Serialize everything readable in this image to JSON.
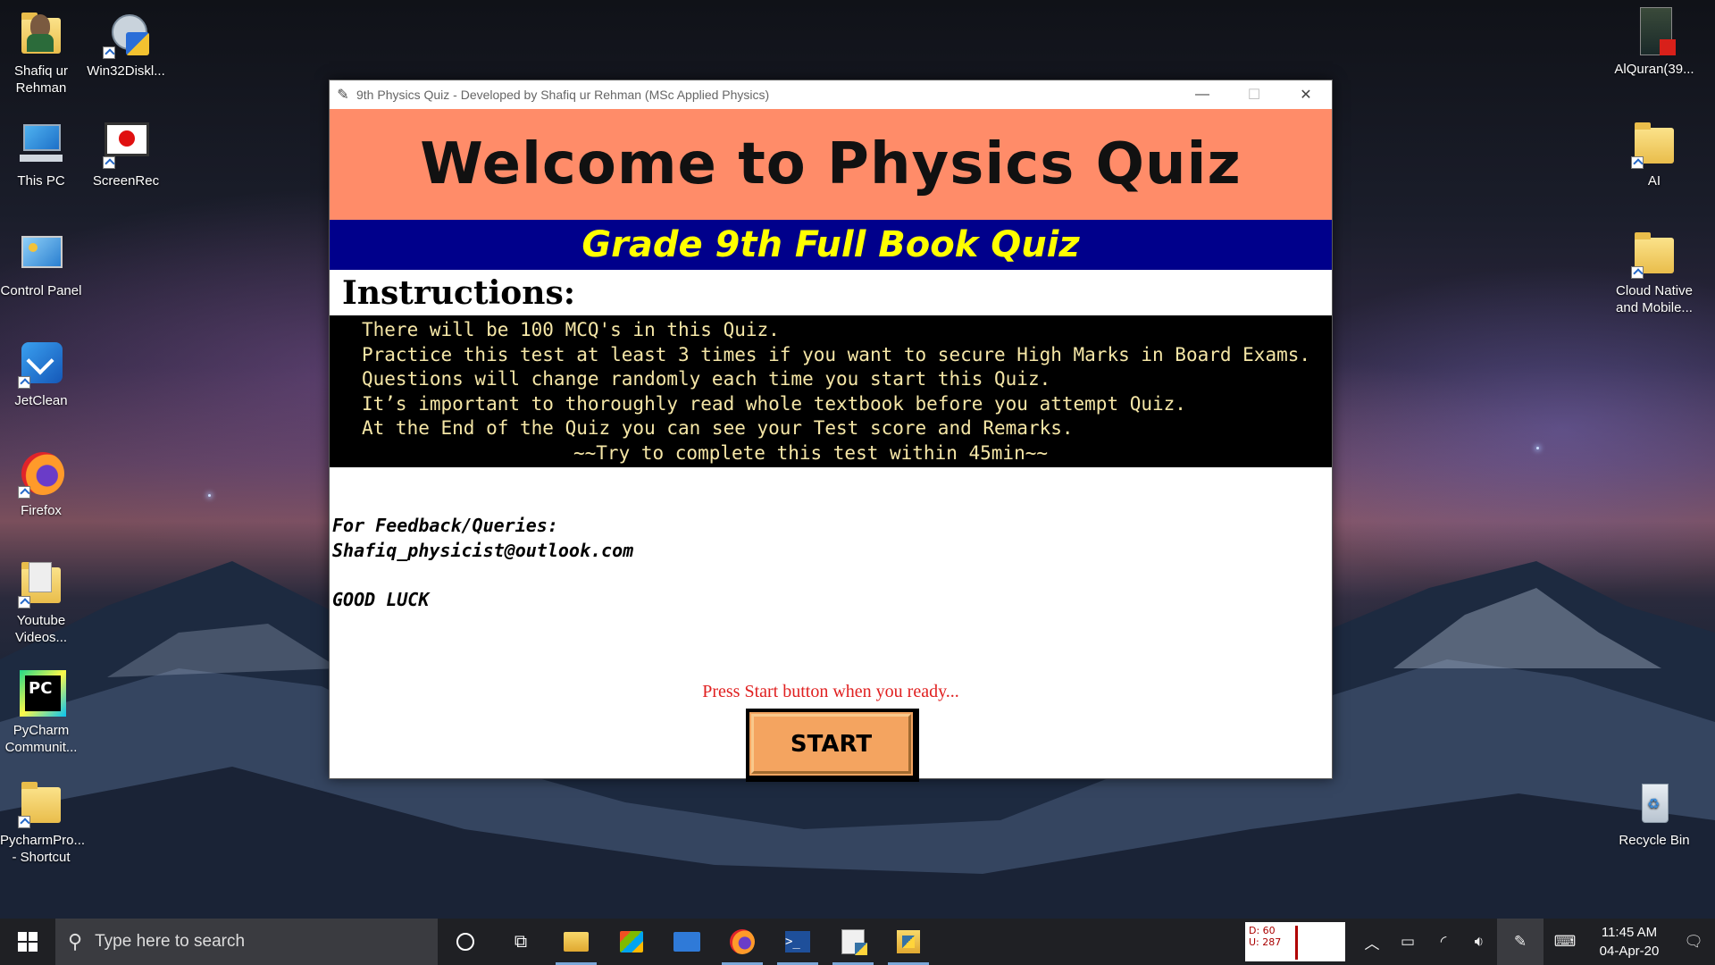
{
  "desktop": {
    "left_icons": [
      {
        "label": "Shafiq ur Rehman",
        "icon": "user-folder-icon"
      },
      {
        "label": "Win32Diskl...",
        "icon": "win32-disk-imager-icon"
      },
      {
        "label": "This PC",
        "icon": "computer-icon"
      },
      {
        "label": "ScreenRec",
        "icon": "screen-recorder-icon"
      },
      {
        "label": "Control Panel",
        "icon": "control-panel-icon"
      },
      {
        "label": "JetClean",
        "icon": "jetclean-icon"
      },
      {
        "label": "Firefox",
        "icon": "firefox-icon"
      },
      {
        "label": "Youtube Videos...",
        "icon": "folder-icon"
      },
      {
        "label": "PyCharm Communit...",
        "icon": "pycharm-icon"
      },
      {
        "label": "PycharmPro... - Shortcut",
        "icon": "folder-icon"
      }
    ],
    "right_icons": [
      {
        "label": "AlQuran(39...",
        "icon": "pdf-book-icon"
      },
      {
        "label": "AI",
        "icon": "folder-icon"
      },
      {
        "label": "Cloud Native and Mobile...",
        "icon": "folder-icon"
      },
      {
        "label": "Recycle Bin",
        "icon": "recycle-bin-icon"
      }
    ]
  },
  "window": {
    "title": "9th Physics Quiz - Developed by Shafiq ur Rehman (MSc Applied Physics)",
    "banner": "Welcome to Physics Quiz",
    "subbanner": "Grade 9th Full Book Quiz",
    "instructions_heading": "Instructions:",
    "instructions": [
      "There will be 100 MCQ's in this Quiz.",
      "Practice this test at least 3 times if you want to secure High Marks in Board Exams.",
      "Questions will change randomly each time you start this Quiz.",
      "It’s important to thoroughly read whole textbook before you attempt Quiz.",
      "At the End of the Quiz you can see your Test score and Remarks.",
      "~~Try to complete this test within 45min~~"
    ],
    "feedback_label": "For Feedback/Queries:",
    "feedback_email": "Shafiq_physicist@outlook.com",
    "good_luck": "GOOD LUCK",
    "ready_prompt": "Press Start button when you ready...",
    "start_label": "START"
  },
  "taskbar": {
    "search_placeholder": "Type here to search",
    "net_download": "D: 60",
    "net_upload": "U: 287",
    "time": "11:45 AM",
    "date": "04-Apr-20"
  },
  "colors": {
    "banner_bg": "#ff8c69",
    "subbanner_bg": "#00008b",
    "subbanner_text": "#ffff00",
    "instructions_text": "#f5e6a6",
    "ready_text": "#e02020",
    "start_bg": "#f4a460"
  }
}
